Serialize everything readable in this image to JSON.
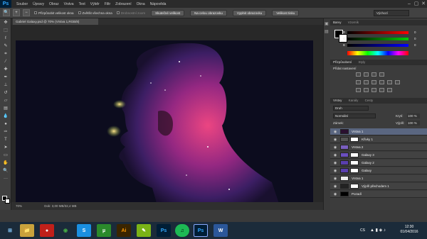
{
  "menubar": {
    "logo": "Ps",
    "items": [
      "Soubor",
      "Úpravy",
      "Obraz",
      "Vrstva",
      "Text",
      "Výběr",
      "Filtr",
      "Zobrazení",
      "Okna",
      "Nápověda"
    ],
    "minimize": "–",
    "restore": "▢",
    "close": "✕"
  },
  "options": {
    "zoom_icon": "🔍",
    "check1": "Přizpůsobit velikost okna",
    "check2": "Zvětšit všechna okna",
    "check3": "Drobnostní zoom",
    "btn1": "Skutečné velikost",
    "btn2": "Na celou obrazovku",
    "btn3": "Vyplnit obrazovku",
    "btn4": "Velikost tisku",
    "workspace": "Výchozí"
  },
  "document": {
    "tab_title": "Gabriel Galaxy.psd @ 70% (Vrstva 1,RGB/8)",
    "zoom": "70%",
    "doc_info": "Dok: 3,00 MB/32,4 MB"
  },
  "panels": {
    "color_tab": "Barvy",
    "swatch_tab": "Vzorník",
    "r_label": "R",
    "g_label": "G",
    "b_label": "B",
    "r": "0",
    "g": "0",
    "b": "0",
    "adjust_tab": "Přizpůsobení",
    "styles_tab": "Styly",
    "adjust_title": "Přidat nastavení",
    "layers_tab": "Vrstvy",
    "channels_tab": "Kanály",
    "paths_tab": "Cesty",
    "kind": "Druh",
    "blend": "Normální",
    "opacity_label": "Krytí:",
    "opacity": "100 %",
    "lock_label": "Zámek:",
    "fill_label": "Výplň:",
    "fill": "100 %"
  },
  "layers": [
    {
      "name": "Vrstva 1",
      "selected": true,
      "thumb": "#2a1030",
      "mask": false
    },
    {
      "name": "Křivky 1",
      "selected": false,
      "thumb": "#555",
      "mask": true
    },
    {
      "name": "Vrstva 2",
      "selected": false,
      "thumb": "#7a5fbf",
      "mask": false
    },
    {
      "name": "Galaxy 3",
      "selected": false,
      "thumb": "#6a4fbf",
      "mask": true
    },
    {
      "name": "Galaxy 2",
      "selected": false,
      "thumb": "#5a3faf",
      "mask": true
    },
    {
      "name": "Galaxy",
      "selected": false,
      "thumb": "#5a3faf",
      "mask": true
    },
    {
      "name": "Vrstva 1",
      "selected": false,
      "thumb": "#eee",
      "mask": false
    },
    {
      "name": "Výplň přechodem 1",
      "selected": false,
      "thumb": "#222",
      "mask": true
    },
    {
      "name": "Pozadí",
      "selected": false,
      "thumb": "#000",
      "mask": false
    }
  ],
  "taskbar": {
    "apps": [
      "⊞",
      "📁",
      "●",
      "◉",
      "S",
      "µ",
      "Ai",
      "✎",
      "Ps",
      "♫",
      "Ps",
      "W"
    ],
    "lang": "CS",
    "time": "12:30",
    "date": "01/04/2016"
  }
}
